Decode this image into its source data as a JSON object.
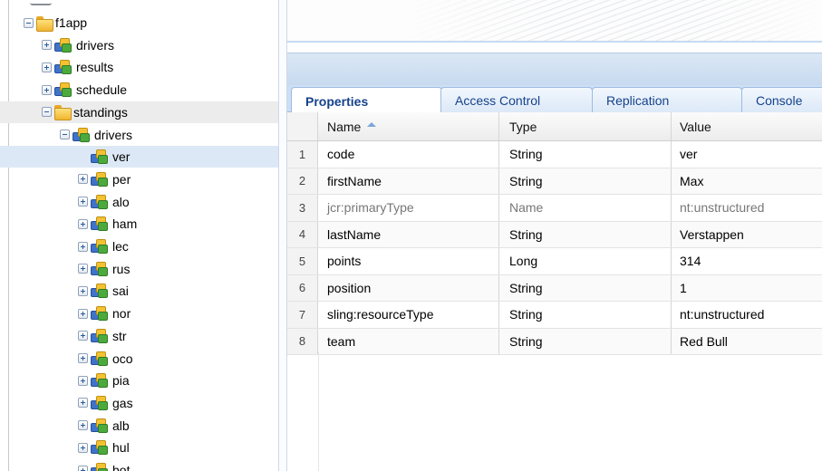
{
  "tree": {
    "nodes": [
      {
        "label": "f1app",
        "icon": "folder-icon",
        "expander": "minus",
        "level": 0,
        "highlight": "none"
      },
      {
        "label": "drivers",
        "icon": "node-icon",
        "expander": "plus",
        "level": 1,
        "highlight": "none"
      },
      {
        "label": "results",
        "icon": "node-icon",
        "expander": "plus",
        "level": 1,
        "highlight": "none"
      },
      {
        "label": "schedule",
        "icon": "node-icon",
        "expander": "plus",
        "level": 1,
        "highlight": "none"
      },
      {
        "label": "standings",
        "icon": "folder-icon",
        "expander": "minus",
        "level": 1,
        "highlight": "grey"
      },
      {
        "label": "drivers",
        "icon": "node-icon",
        "expander": "minus",
        "level": 2,
        "highlight": "none"
      },
      {
        "label": "ver",
        "icon": "node-icon",
        "expander": "none",
        "level": 3,
        "highlight": "blue"
      },
      {
        "label": "per",
        "icon": "node-icon",
        "expander": "plus",
        "level": 3,
        "highlight": "none"
      },
      {
        "label": "alo",
        "icon": "node-icon",
        "expander": "plus",
        "level": 3,
        "highlight": "none"
      },
      {
        "label": "ham",
        "icon": "node-icon",
        "expander": "plus",
        "level": 3,
        "highlight": "none"
      },
      {
        "label": "lec",
        "icon": "node-icon",
        "expander": "plus",
        "level": 3,
        "highlight": "none"
      },
      {
        "label": "rus",
        "icon": "node-icon",
        "expander": "plus",
        "level": 3,
        "highlight": "none"
      },
      {
        "label": "sai",
        "icon": "node-icon",
        "expander": "plus",
        "level": 3,
        "highlight": "none"
      },
      {
        "label": "nor",
        "icon": "node-icon",
        "expander": "plus",
        "level": 3,
        "highlight": "none"
      },
      {
        "label": "str",
        "icon": "node-icon",
        "expander": "plus",
        "level": 3,
        "highlight": "none"
      },
      {
        "label": "oco",
        "icon": "node-icon",
        "expander": "plus",
        "level": 3,
        "highlight": "none"
      },
      {
        "label": "pia",
        "icon": "node-icon",
        "expander": "plus",
        "level": 3,
        "highlight": "none"
      },
      {
        "label": "gas",
        "icon": "node-icon",
        "expander": "plus",
        "level": 3,
        "highlight": "none"
      },
      {
        "label": "alb",
        "icon": "node-icon",
        "expander": "plus",
        "level": 3,
        "highlight": "none"
      },
      {
        "label": "hul",
        "icon": "node-icon",
        "expander": "plus",
        "level": 3,
        "highlight": "none"
      },
      {
        "label": "bot",
        "icon": "node-icon",
        "expander": "plus",
        "level": 3,
        "highlight": "none"
      }
    ]
  },
  "tabs": [
    {
      "label": "Properties",
      "active": true
    },
    {
      "label": "Access Control",
      "active": false
    },
    {
      "label": "Replication",
      "active": false
    },
    {
      "label": "Console",
      "active": false
    }
  ],
  "grid": {
    "columns": {
      "name": "Name",
      "type": "Type",
      "value": "Value"
    },
    "sort": {
      "column": "name",
      "direction": "ascending"
    },
    "rows": [
      {
        "num": "1",
        "name": "code",
        "type": "String",
        "value": "ver",
        "muted": false
      },
      {
        "num": "2",
        "name": "firstName",
        "type": "String",
        "value": "Max",
        "muted": false
      },
      {
        "num": "3",
        "name": "jcr:primaryType",
        "type": "Name",
        "value": "nt:unstructured",
        "muted": true
      },
      {
        "num": "4",
        "name": "lastName",
        "type": "String",
        "value": "Verstappen",
        "muted": false
      },
      {
        "num": "5",
        "name": "points",
        "type": "Long",
        "value": "314",
        "muted": false
      },
      {
        "num": "6",
        "name": "position",
        "type": "String",
        "value": "1",
        "muted": false
      },
      {
        "num": "7",
        "name": "sling:resourceType",
        "type": "String",
        "value": "nt:unstructured",
        "muted": false
      },
      {
        "num": "8",
        "name": "team",
        "type": "String",
        "value": "Red Bull",
        "muted": false
      }
    ]
  },
  "colors": {
    "tab_text": "#15428b",
    "tab_strip": "#cddff4",
    "selected_row": "#dde8f6",
    "hover_row": "#ececec"
  }
}
